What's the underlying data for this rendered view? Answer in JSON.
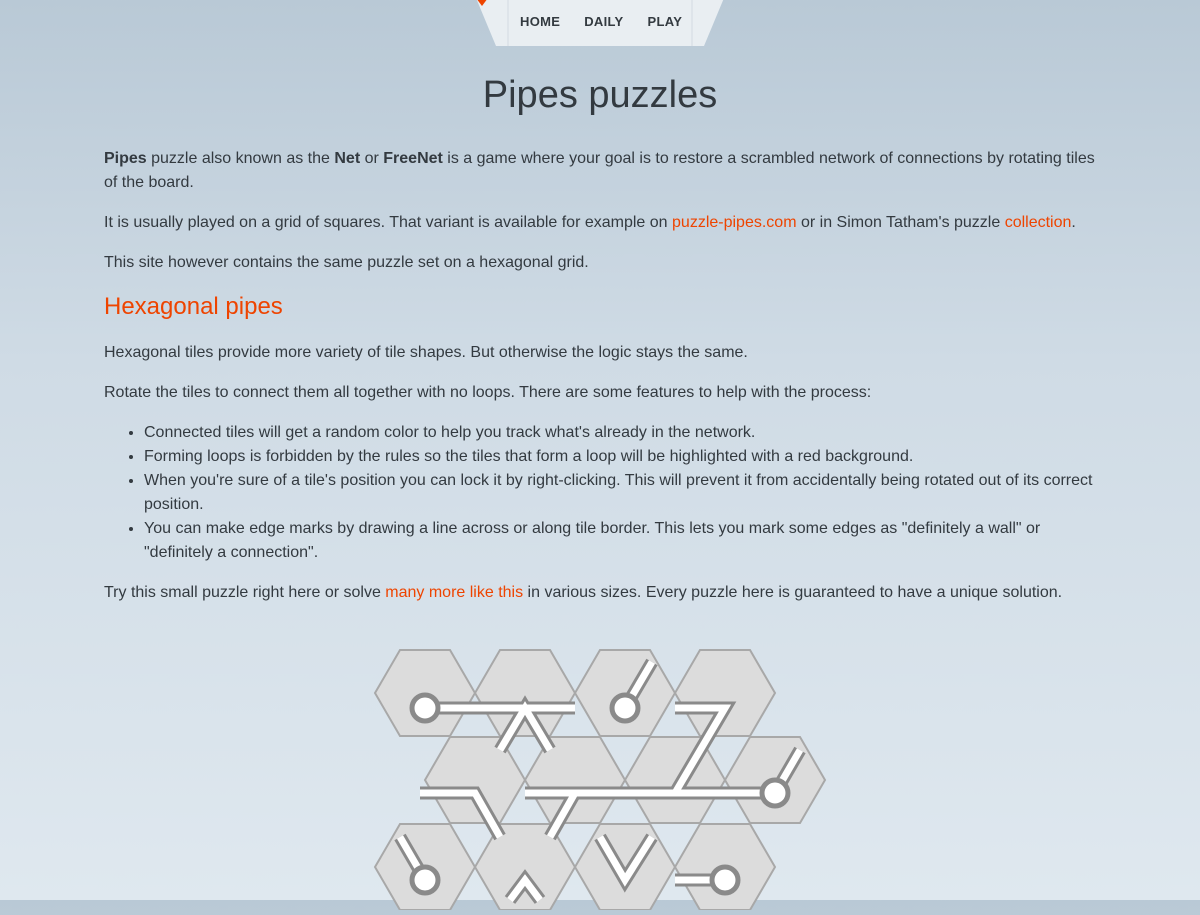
{
  "nav": {
    "items": [
      {
        "label": "HOME"
      },
      {
        "label": "DAILY"
      },
      {
        "label": "PLAY"
      }
    ]
  },
  "page": {
    "title": "Pipes puzzles",
    "intro": {
      "b1": "Pipes",
      "t1": " puzzle also known as the ",
      "b2": "Net",
      "t2": " or ",
      "b3": "FreeNet",
      "t3": " is a game where your goal is to restore a scrambled network of connections by rotating tiles of the board."
    },
    "variant": {
      "t1": "It is usually played on a grid of squares. That variant is available for example on ",
      "link1": "puzzle-pipes.com",
      "t2": " or in Simon Tatham's puzzle ",
      "link2": "collection",
      "t3": "."
    },
    "hex_note": "This site however contains the same puzzle set on a hexagonal grid.",
    "section_title": "Hexagonal pipes",
    "hex_p1": "Hexagonal tiles provide more variety of tile shapes. But otherwise the logic stays the same.",
    "hex_p2": "Rotate the tiles to connect them all together with no loops. There are some features to help with the process:",
    "features": [
      "Connected tiles will get a random color to help you track what's already in the network.",
      "Forming loops is forbidden by the rules so the tiles that form a loop will be highlighted with a red background.",
      "When you're sure of a tile's position you can lock it by right-clicking. This will prevent it from accidentally being rotated out of its correct position.",
      "You can make edge marks by drawing a line across or along tile border. This lets you mark some edges as \"definitely a wall\" or \"definitely a connection\"."
    ],
    "try": {
      "t1": "Try this small puzzle right here or solve ",
      "link": "many more like this",
      "t2": " in various sizes. Every puzzle here is guaranteed to have a unique solution."
    }
  },
  "colors": {
    "accent": "#ee4400",
    "tile_fill": "#dcdcdc",
    "tile_stroke": "#a8a8a8",
    "pipe_outline": "#8a8a8a",
    "pipe_fill": "#ffffff"
  }
}
